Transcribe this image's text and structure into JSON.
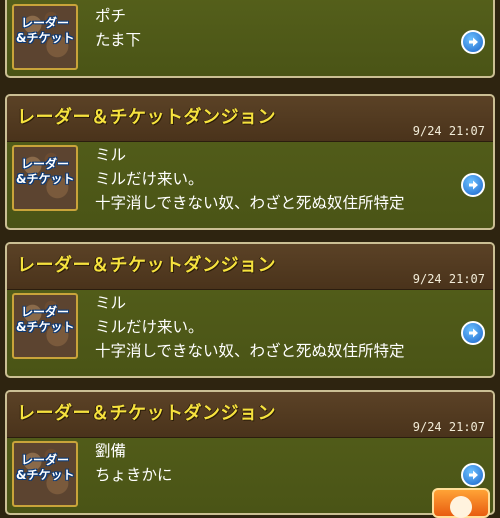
{
  "cards": [
    {
      "title": "",
      "time": "",
      "lines": [
        "ポチ",
        "たま下"
      ],
      "thumb_text": "レーダー\n&チケット",
      "icon": "arrow-right-icon"
    },
    {
      "title": "レーダー＆チケットダンジョン",
      "time": "9/24 21:07",
      "lines": [
        "ミル",
        "ミルだけ来い。",
        "十字消しできない奴、わざと死ぬ奴住所特定"
      ],
      "thumb_text": "レーダー\n&チケット",
      "icon": "arrow-right-icon"
    },
    {
      "title": "レーダー＆チケットダンジョン",
      "time": "9/24 21:07",
      "lines": [
        "ミル",
        "ミルだけ来い。",
        "十字消しできない奴、わざと死ぬ奴住所特定"
      ],
      "thumb_text": "レーダー\n&チケット",
      "icon": "arrow-right-icon"
    },
    {
      "title": "レーダー＆チケットダンジョン",
      "time": "9/24 21:07",
      "lines": [
        "劉備",
        "ちょきかに"
      ],
      "thumb_text": "レーダー\n&チケット",
      "icon": "arrow-right-icon"
    }
  ],
  "colors": {
    "title": "#f6e23e",
    "card_body": "#55601b",
    "card_header": "#5b4226",
    "arrow": "#1a63c9",
    "button": "#ff8a2a"
  }
}
